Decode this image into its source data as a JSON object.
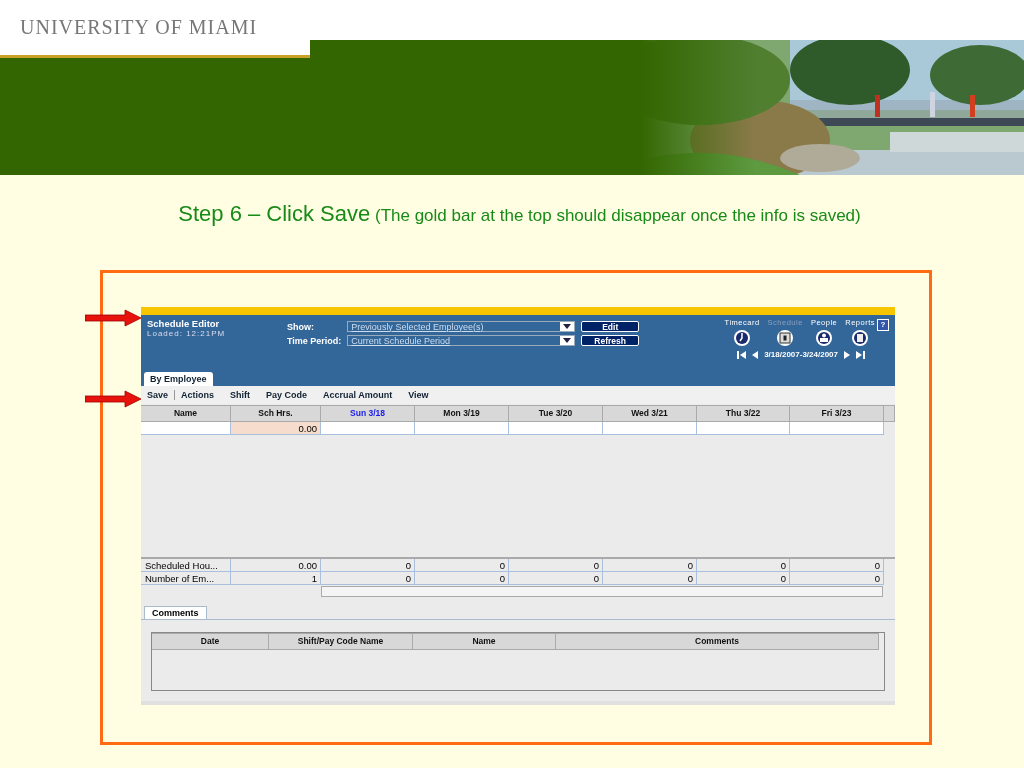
{
  "banner": {
    "logo": "UNIVERSITY OF MIAMI",
    "kind": "picture"
  },
  "heading": {
    "step": "Step 6 – Click Save",
    "note": "(The gold bar at the top should disappear once the info is saved)"
  },
  "app": {
    "unsaved_bar": true,
    "title": "Schedule Editor",
    "loaded": "Loaded: 12:21PM",
    "show_label": "Show:",
    "show_value": "Previously Selected Employee(s)",
    "edit_button": "Edit",
    "period_label": "Time Period:",
    "period_value": "Current Schedule Period",
    "refresh_button": "Refresh",
    "nav": [
      {
        "label": "Timecard",
        "kind": "clock",
        "selected": false
      },
      {
        "label": "Schedule",
        "kind": "calendar",
        "selected": true
      },
      {
        "label": "People",
        "kind": "person",
        "selected": false
      },
      {
        "label": "Reports",
        "kind": "report",
        "selected": false
      }
    ],
    "help": "?",
    "date_range": "3/18/2007-3/24/2007",
    "tabs": [
      {
        "label": "By Employee",
        "selected": true
      }
    ],
    "toolbar": [
      "Save",
      "Actions",
      "Shift",
      "Pay Code",
      "Accrual Amount",
      "View"
    ],
    "columns": [
      {
        "label": "Name",
        "selected": false
      },
      {
        "label": "Sch Hrs.",
        "selected": false
      },
      {
        "label": "Sun 3/18",
        "selected": true
      },
      {
        "label": "Mon 3/19",
        "selected": false
      },
      {
        "label": "Tue 3/20",
        "selected": false
      },
      {
        "label": "Wed 3/21",
        "selected": false
      },
      {
        "label": "Thu 3/22",
        "selected": false
      },
      {
        "label": "Fri 3/23",
        "selected": false
      }
    ],
    "rows": [
      {
        "sch_hrs": "0.00"
      }
    ],
    "totals": [
      {
        "label": "Scheduled Hou...",
        "values": [
          "0.00",
          "0",
          "0",
          "0",
          "0",
          "0",
          "0"
        ]
      },
      {
        "label": "Number of Em...",
        "values": [
          "1",
          "0",
          "0",
          "0",
          "0",
          "0",
          "0"
        ]
      }
    ],
    "comments": {
      "tab": "Comments",
      "columns": [
        "Date",
        "Shift/Pay Code Name",
        "Name",
        "Comments"
      ]
    }
  }
}
